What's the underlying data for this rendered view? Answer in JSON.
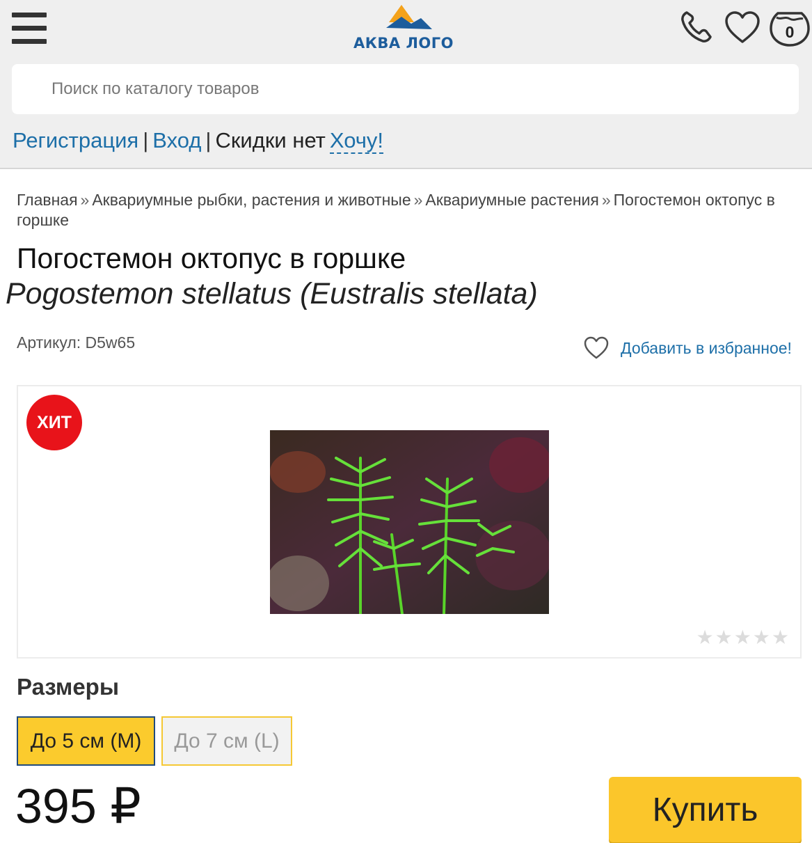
{
  "header": {
    "logo_text": "АКВА ЛОГО",
    "cart_count": "0",
    "icons": [
      "menu-icon",
      "phone-icon",
      "heart-icon",
      "cart-icon"
    ]
  },
  "search": {
    "placeholder": "Поиск по каталогу товаров"
  },
  "auth": {
    "register": "Регистрация",
    "separator": "|",
    "login": "Вход",
    "discount": "Скидки нет",
    "want": "Хочу!"
  },
  "breadcrumb": {
    "items": [
      "Главная",
      "Аквариумные рыбки, растения и животные",
      "Аквариумные растения",
      "Погостемон октопус в горшке"
    ],
    "arrow": "»"
  },
  "product": {
    "title": "Погостемон октопус в горшке",
    "latin_name": "Pogostemon stellatus (Eustralis stellata)",
    "sku": "Артикул: D5w65",
    "add_favorite": "Добавить в избранное!",
    "badge": "ХИТ",
    "rating": 0,
    "rating_max": 5,
    "stars": "★★★★★",
    "sizes_title": "Размеры",
    "sizes": [
      "До 5 см (M)",
      "До 7 см (L)"
    ],
    "selected_size": "До 5 см (M)",
    "price": "395 ₽",
    "buy_label": "Купить"
  },
  "colors": {
    "header_bg": "#efefef",
    "link": "#1d6fa8",
    "logo_blue": "#1d5d9c",
    "logo_orange": "#f4a21b",
    "accent_yellow": "#fbc62b",
    "badge_red": "#e8131a",
    "selected_border": "#1f4a7d"
  }
}
